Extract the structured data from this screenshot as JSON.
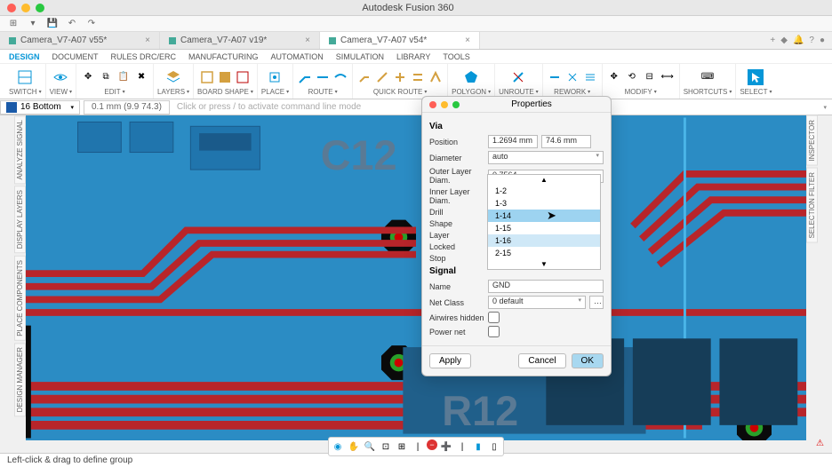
{
  "app": {
    "title": "Autodesk Fusion 360"
  },
  "tabs": [
    {
      "name": "Camera_V7-A07 v55*",
      "active": false
    },
    {
      "name": "Camera_V7-A07 v19*",
      "active": false
    },
    {
      "name": "Camera_V7-A07 v54*",
      "active": true
    }
  ],
  "menu": [
    "DESIGN",
    "DOCUMENT",
    "RULES DRC/ERC",
    "MANUFACTURING",
    "AUTOMATION",
    "SIMULATION",
    "LIBRARY",
    "TOOLS"
  ],
  "ribbon": [
    {
      "label": "SWITCH"
    },
    {
      "label": "VIEW"
    },
    {
      "label": "EDIT"
    },
    {
      "label": "LAYERS"
    },
    {
      "label": "BOARD SHAPE"
    },
    {
      "label": "PLACE"
    },
    {
      "label": "ROUTE"
    },
    {
      "label": "QUICK ROUTE"
    },
    {
      "label": "POLYGON"
    },
    {
      "label": "UNROUTE"
    },
    {
      "label": "REWORK"
    },
    {
      "label": "MODIFY"
    },
    {
      "label": "SHORTCUTS"
    },
    {
      "label": "SELECT"
    }
  ],
  "layer": {
    "name": "16 Bottom",
    "grid": "0.1 mm (9.9 74.3)"
  },
  "cmd_placeholder": "Click or press / to activate command line mode",
  "side_left": [
    "ANALYZE SIGNAL",
    "DISPLAY LAYERS",
    "PLACE COMPONENTS",
    "DESIGN MANAGER"
  ],
  "side_right": [
    "INSPECTOR",
    "SELECTION FILTER"
  ],
  "canvas_labels": [
    "C12",
    "R12"
  ],
  "dialog": {
    "title": "Properties",
    "section1": "Via",
    "position_label": "Position",
    "position_x": "1.2694 mm",
    "position_y": "74.6 mm",
    "diameter_label": "Diameter",
    "diameter_value": "auto",
    "outer_label": "Outer Layer Diam.",
    "outer_value": "0.7564",
    "inner_label": "Inner Layer Diam.",
    "drill_label": "Drill",
    "shape_label": "Shape",
    "layer_label": "Layer",
    "locked_label": "Locked",
    "stop_label": "Stop",
    "section2": "Signal",
    "name_label": "Name",
    "name_value": "GND",
    "netclass_label": "Net Class",
    "netclass_value": "0 default",
    "airwires_label": "Airwires hidden",
    "powernet_label": "Power net",
    "apply": "Apply",
    "cancel": "Cancel",
    "ok": "OK"
  },
  "dropdown": {
    "items": [
      "1-2",
      "1-3",
      "1-14",
      "1-15",
      "1-16",
      "2-15"
    ],
    "highlighted": "1-14",
    "selected": "1-16"
  },
  "status": "Left-click & drag to define group"
}
